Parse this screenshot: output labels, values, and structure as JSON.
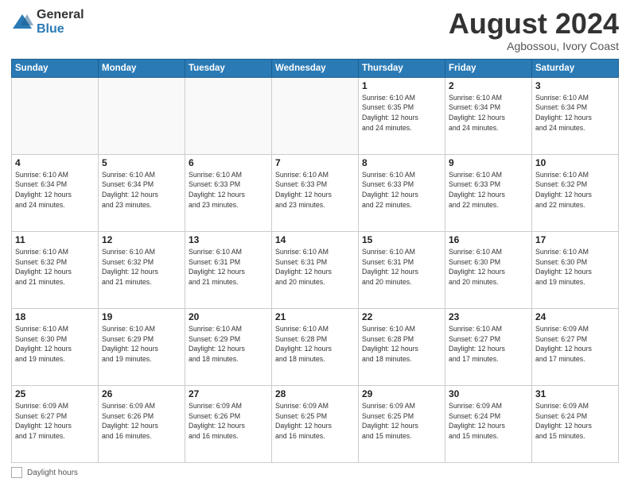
{
  "header": {
    "logo_general": "General",
    "logo_blue": "Blue",
    "title": "August 2024",
    "location": "Agbossou, Ivory Coast"
  },
  "days_of_week": [
    "Sunday",
    "Monday",
    "Tuesday",
    "Wednesday",
    "Thursday",
    "Friday",
    "Saturday"
  ],
  "weeks": [
    [
      {
        "day": "",
        "info": ""
      },
      {
        "day": "",
        "info": ""
      },
      {
        "day": "",
        "info": ""
      },
      {
        "day": "",
        "info": ""
      },
      {
        "day": "1",
        "info": "Sunrise: 6:10 AM\nSunset: 6:35 PM\nDaylight: 12 hours\nand 24 minutes."
      },
      {
        "day": "2",
        "info": "Sunrise: 6:10 AM\nSunset: 6:34 PM\nDaylight: 12 hours\nand 24 minutes."
      },
      {
        "day": "3",
        "info": "Sunrise: 6:10 AM\nSunset: 6:34 PM\nDaylight: 12 hours\nand 24 minutes."
      }
    ],
    [
      {
        "day": "4",
        "info": "Sunrise: 6:10 AM\nSunset: 6:34 PM\nDaylight: 12 hours\nand 24 minutes."
      },
      {
        "day": "5",
        "info": "Sunrise: 6:10 AM\nSunset: 6:34 PM\nDaylight: 12 hours\nand 23 minutes."
      },
      {
        "day": "6",
        "info": "Sunrise: 6:10 AM\nSunset: 6:33 PM\nDaylight: 12 hours\nand 23 minutes."
      },
      {
        "day": "7",
        "info": "Sunrise: 6:10 AM\nSunset: 6:33 PM\nDaylight: 12 hours\nand 23 minutes."
      },
      {
        "day": "8",
        "info": "Sunrise: 6:10 AM\nSunset: 6:33 PM\nDaylight: 12 hours\nand 22 minutes."
      },
      {
        "day": "9",
        "info": "Sunrise: 6:10 AM\nSunset: 6:33 PM\nDaylight: 12 hours\nand 22 minutes."
      },
      {
        "day": "10",
        "info": "Sunrise: 6:10 AM\nSunset: 6:32 PM\nDaylight: 12 hours\nand 22 minutes."
      }
    ],
    [
      {
        "day": "11",
        "info": "Sunrise: 6:10 AM\nSunset: 6:32 PM\nDaylight: 12 hours\nand 21 minutes."
      },
      {
        "day": "12",
        "info": "Sunrise: 6:10 AM\nSunset: 6:32 PM\nDaylight: 12 hours\nand 21 minutes."
      },
      {
        "day": "13",
        "info": "Sunrise: 6:10 AM\nSunset: 6:31 PM\nDaylight: 12 hours\nand 21 minutes."
      },
      {
        "day": "14",
        "info": "Sunrise: 6:10 AM\nSunset: 6:31 PM\nDaylight: 12 hours\nand 20 minutes."
      },
      {
        "day": "15",
        "info": "Sunrise: 6:10 AM\nSunset: 6:31 PM\nDaylight: 12 hours\nand 20 minutes."
      },
      {
        "day": "16",
        "info": "Sunrise: 6:10 AM\nSunset: 6:30 PM\nDaylight: 12 hours\nand 20 minutes."
      },
      {
        "day": "17",
        "info": "Sunrise: 6:10 AM\nSunset: 6:30 PM\nDaylight: 12 hours\nand 19 minutes."
      }
    ],
    [
      {
        "day": "18",
        "info": "Sunrise: 6:10 AM\nSunset: 6:30 PM\nDaylight: 12 hours\nand 19 minutes."
      },
      {
        "day": "19",
        "info": "Sunrise: 6:10 AM\nSunset: 6:29 PM\nDaylight: 12 hours\nand 19 minutes."
      },
      {
        "day": "20",
        "info": "Sunrise: 6:10 AM\nSunset: 6:29 PM\nDaylight: 12 hours\nand 18 minutes."
      },
      {
        "day": "21",
        "info": "Sunrise: 6:10 AM\nSunset: 6:28 PM\nDaylight: 12 hours\nand 18 minutes."
      },
      {
        "day": "22",
        "info": "Sunrise: 6:10 AM\nSunset: 6:28 PM\nDaylight: 12 hours\nand 18 minutes."
      },
      {
        "day": "23",
        "info": "Sunrise: 6:10 AM\nSunset: 6:27 PM\nDaylight: 12 hours\nand 17 minutes."
      },
      {
        "day": "24",
        "info": "Sunrise: 6:09 AM\nSunset: 6:27 PM\nDaylight: 12 hours\nand 17 minutes."
      }
    ],
    [
      {
        "day": "25",
        "info": "Sunrise: 6:09 AM\nSunset: 6:27 PM\nDaylight: 12 hours\nand 17 minutes."
      },
      {
        "day": "26",
        "info": "Sunrise: 6:09 AM\nSunset: 6:26 PM\nDaylight: 12 hours\nand 16 minutes."
      },
      {
        "day": "27",
        "info": "Sunrise: 6:09 AM\nSunset: 6:26 PM\nDaylight: 12 hours\nand 16 minutes."
      },
      {
        "day": "28",
        "info": "Sunrise: 6:09 AM\nSunset: 6:25 PM\nDaylight: 12 hours\nand 16 minutes."
      },
      {
        "day": "29",
        "info": "Sunrise: 6:09 AM\nSunset: 6:25 PM\nDaylight: 12 hours\nand 15 minutes."
      },
      {
        "day": "30",
        "info": "Sunrise: 6:09 AM\nSunset: 6:24 PM\nDaylight: 12 hours\nand 15 minutes."
      },
      {
        "day": "31",
        "info": "Sunrise: 6:09 AM\nSunset: 6:24 PM\nDaylight: 12 hours\nand 15 minutes."
      }
    ]
  ],
  "footer": {
    "label": "Daylight hours"
  }
}
